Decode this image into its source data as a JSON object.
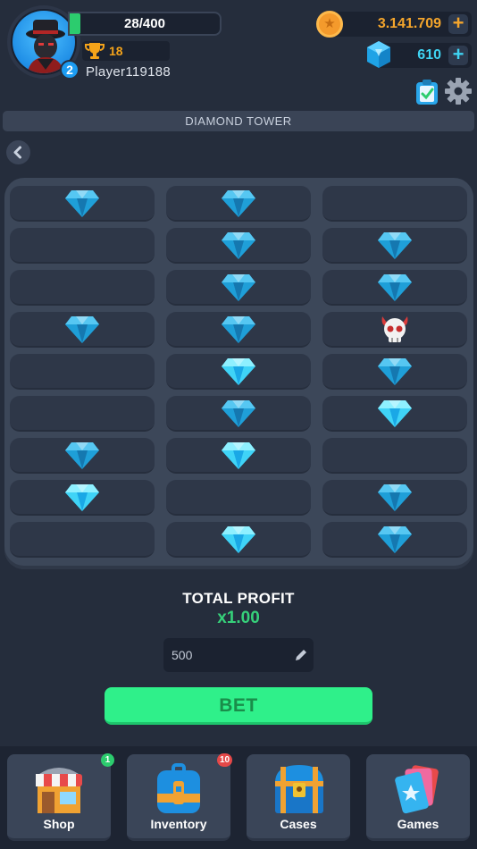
{
  "player": {
    "name": "Player119188",
    "level": "2",
    "xp_text": "28/400",
    "xp_fraction": 0.07,
    "trophies": "18"
  },
  "currency": {
    "coins": "3.141.709",
    "gems": "610",
    "plus": "+"
  },
  "game": {
    "title": "DIAMOND TOWER",
    "grid_rows": [
      [
        "gem",
        "gem",
        "empty"
      ],
      [
        "empty",
        "gem",
        "gem"
      ],
      [
        "empty",
        "gem",
        "gem"
      ],
      [
        "gem",
        "gem",
        "skull"
      ],
      [
        "empty",
        "gem-bright",
        "gem"
      ],
      [
        "empty",
        "gem",
        "gem-bright"
      ],
      [
        "gem",
        "gem-bright",
        "empty"
      ],
      [
        "gem-bright",
        "empty",
        "gem"
      ],
      [
        "empty",
        "gem-bright",
        "gem"
      ]
    ]
  },
  "profit": {
    "label": "TOTAL PROFIT",
    "value": "x1.00"
  },
  "bet": {
    "amount": "500",
    "button_label": "BET"
  },
  "nav": {
    "items": [
      {
        "label": "Shop",
        "badge": "1",
        "badge_color": "#2ccc6e"
      },
      {
        "label": "Inventory",
        "badge": "10",
        "badge_color": "#e54848"
      },
      {
        "label": "Cases",
        "badge": "",
        "badge_color": ""
      },
      {
        "label": "Games",
        "badge": "",
        "badge_color": ""
      }
    ]
  },
  "colors": {
    "background": "#252d3c",
    "accent_green": "#2ff08a",
    "coin": "#f4a52c",
    "gem": "#3fd3f2"
  }
}
